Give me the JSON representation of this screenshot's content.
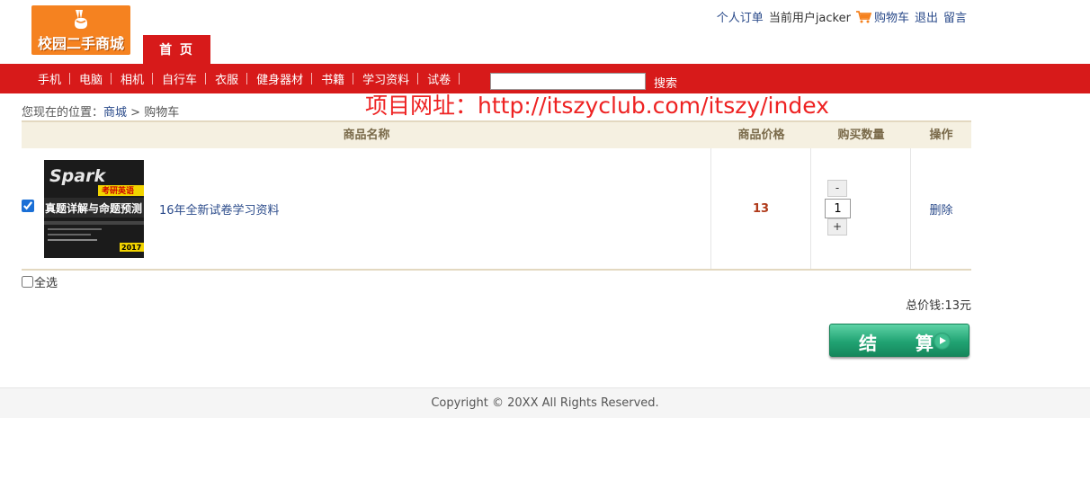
{
  "logo": {
    "text": "校园二手商城",
    "icon": "victory-hand-icon"
  },
  "home_tab": "首 页",
  "top_links": {
    "orders": "个人订单",
    "current_user": "当前用户jacker",
    "cart": "购物车",
    "cart_icon": "cart-icon",
    "logout": "退出",
    "message": "留言"
  },
  "nav": {
    "items": [
      "手机",
      "电脑",
      "相机",
      "自行车",
      "衣服",
      "健身器材",
      "书籍",
      "学习资料",
      "试卷"
    ],
    "search_value": "",
    "search_button": "搜索"
  },
  "breadcrumb": {
    "prefix": "您现在的位置：",
    "mall": "商城",
    "sep": ">",
    "current": "购物车"
  },
  "watermark": "项目网址：http://itszyclub.com/itszy/index",
  "table": {
    "headers": {
      "name": "商品名称",
      "price": "商品价格",
      "qty": "购买数量",
      "op": "操作"
    },
    "rows": [
      {
        "checked": true,
        "title": "16年全新试卷学习资料",
        "thumb_text": {
          "brand": "Spark",
          "line1": "考研英语",
          "line2": "真题详解与命题预测",
          "corner": "2017"
        },
        "price": "13",
        "qty_minus": "-",
        "qty_value": "1",
        "qty_plus": "+",
        "delete": "删除"
      }
    ]
  },
  "select_all": "全选",
  "total": "总价钱:13元",
  "checkout_button": "结 算",
  "footer": "Copyright © 20XX All Rights Reserved.",
  "colors": {
    "nav_red": "#d71a1a",
    "logo_orange": "#f58220",
    "link_blue": "#2a4a8a",
    "checkout_green": "#21a373"
  }
}
